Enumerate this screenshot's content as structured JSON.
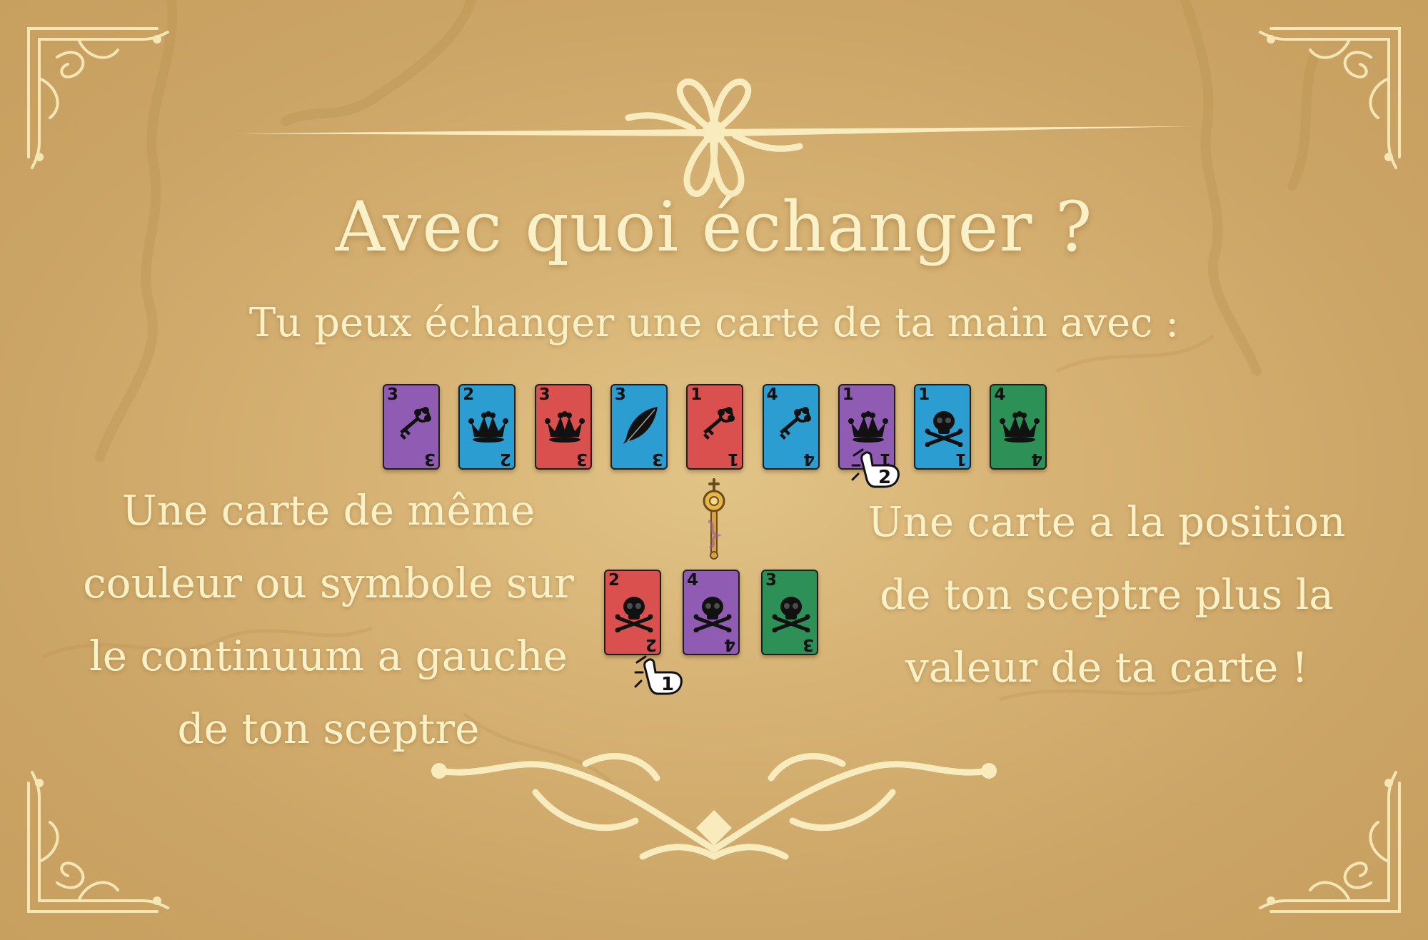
{
  "title": "Avec quoi échanger ?",
  "subtitle": "Tu peux échanger une carte de ta main avec :",
  "left_text": [
    "Une carte de même",
    "couleur ou symbole sur",
    "le continuum a gauche",
    "de ton sceptre"
  ],
  "right_text": [
    "Une carte a la position",
    "de ton sceptre plus la",
    "valeur de ta carte !"
  ],
  "continuum_cards": [
    {
      "value": "3",
      "color": "purple",
      "symbol": "key"
    },
    {
      "value": "2",
      "color": "blue",
      "symbol": "crown"
    },
    {
      "value": "3",
      "color": "red",
      "symbol": "crown"
    },
    {
      "value": "3",
      "color": "blue",
      "symbol": "feather"
    },
    {
      "value": "1",
      "color": "red",
      "symbol": "key"
    },
    {
      "value": "4",
      "color": "blue",
      "symbol": "key"
    },
    {
      "value": "1",
      "color": "purple",
      "symbol": "crown"
    },
    {
      "value": "1",
      "color": "blue",
      "symbol": "skull"
    },
    {
      "value": "4",
      "color": "green",
      "symbol": "crown"
    }
  ],
  "hand_cards": [
    {
      "value": "2",
      "color": "red",
      "symbol": "skull"
    },
    {
      "value": "4",
      "color": "purple",
      "symbol": "skull"
    },
    {
      "value": "3",
      "color": "green",
      "symbol": "skull"
    }
  ],
  "pointers": [
    {
      "label": "1",
      "target": "hand card 1"
    },
    {
      "label": "2",
      "target": "continuum card 7"
    }
  ],
  "colors": {
    "background": "#d6b274",
    "text": "#fbf1c9",
    "purple": "#8f5bb3",
    "blue": "#2b9dd0",
    "red": "#d9504f",
    "green": "#2d9157"
  }
}
